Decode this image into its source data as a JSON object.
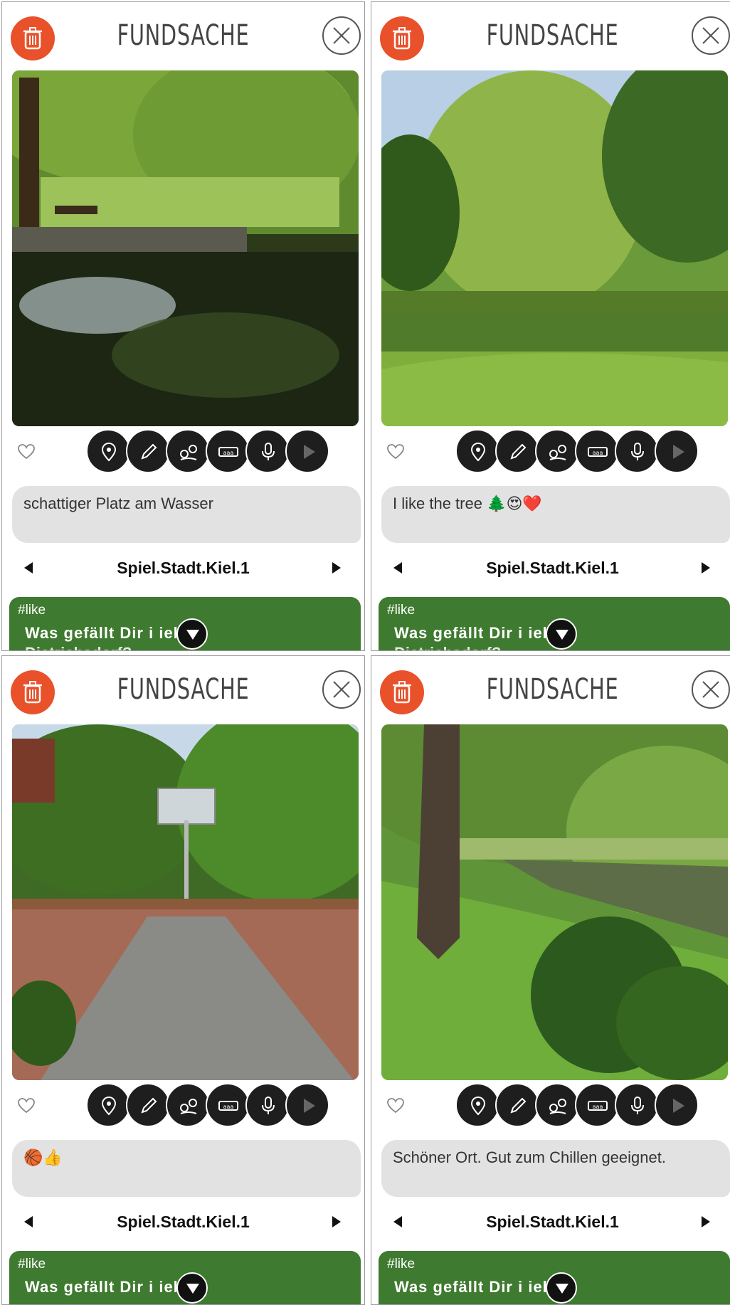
{
  "colors": {
    "accent_orange": "#e8512a",
    "topic_green": "#3e7a2f",
    "comment_bg": "#e2e2e2",
    "action_dark": "#1e1e1e"
  },
  "cards": [
    {
      "title": "FUNDSACHE",
      "comment": "schattiger Platz am Wasser",
      "location": "Spiel.Stadt.Kiel.1",
      "tag": "#like",
      "question": "Was gefällt Dir i  iel-",
      "question_cut": "Dietrichsdorf?",
      "photo": "park-pond"
    },
    {
      "title": "FUNDSACHE",
      "comment": "I like the tree 🌲😍❤️",
      "location": "Spiel.Stadt.Kiel.1",
      "tag": "#like",
      "question": "Was gefällt Dir i  iel-",
      "question_cut": "Dietrichsdorf?",
      "photo": "willow-tree"
    },
    {
      "title": "FUNDSACHE",
      "comment": "🏀👍",
      "location": "Spiel.Stadt.Kiel.1",
      "tag": "#like",
      "question": "Was gefällt Dir i  iel-",
      "question_cut": "",
      "photo": "basketball-court"
    },
    {
      "title": "FUNDSACHE",
      "comment": "Schöner Ort. Gut zum Chillen geeignet.",
      "location": "Spiel.Stadt.Kiel.1",
      "tag": "#like",
      "question": "Was gefällt Dir i  iel-",
      "question_cut": "",
      "photo": "riverbank-tree"
    }
  ],
  "icons": {
    "delete": "trash-icon",
    "close": "close-icon",
    "like": "heart-icon",
    "actions": [
      "location-pin-icon",
      "pencil-icon",
      "map-route-icon",
      "keyboard-icon",
      "microphone-icon",
      "play-icon"
    ],
    "prev": "arrow-left-icon",
    "next": "arrow-right-icon",
    "expand": "chevron-down-icon"
  }
}
